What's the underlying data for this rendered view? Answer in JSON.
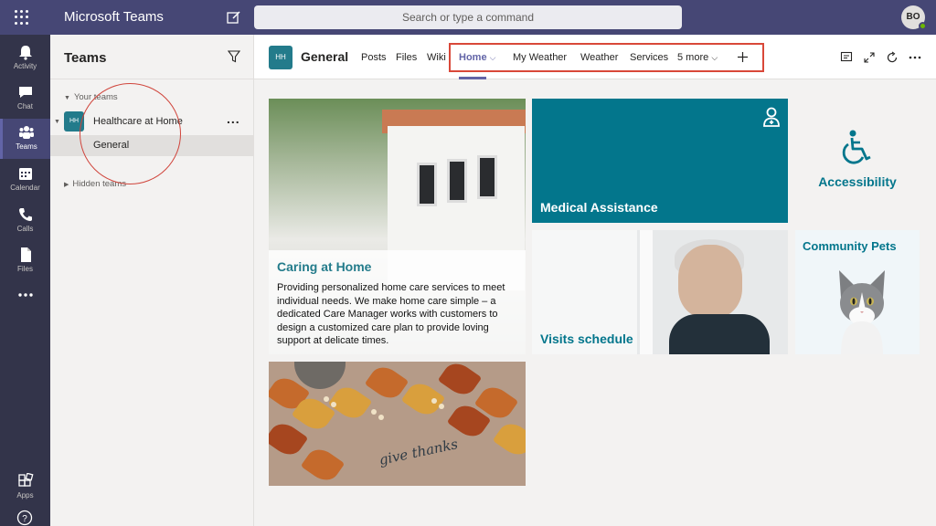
{
  "titlebar": {
    "app_title": "Microsoft Teams",
    "search_placeholder": "Search or type a command",
    "avatar_initials": "BO"
  },
  "appbar": {
    "items": [
      {
        "label": "Activity",
        "icon": "bell-icon"
      },
      {
        "label": "Chat",
        "icon": "chat-icon"
      },
      {
        "label": "Teams",
        "icon": "teams-icon"
      },
      {
        "label": "Calendar",
        "icon": "calendar-icon"
      },
      {
        "label": "Calls",
        "icon": "phone-icon"
      },
      {
        "label": "Files",
        "icon": "file-icon"
      },
      {
        "label": "",
        "icon": "more-icon"
      }
    ],
    "apps_label": "Apps"
  },
  "teams_pane": {
    "header": "Teams",
    "your_teams_label": "Your teams",
    "team": {
      "initials": "HH",
      "name": "Healthcare at Home",
      "more": "..."
    },
    "channel": "General",
    "hidden_teams_label": "Hidden teams"
  },
  "channel_header": {
    "initials": "HH",
    "title": "General",
    "tabs": [
      "Posts",
      "Files",
      "Wiki",
      "Home",
      "My Weather",
      "Weather",
      "Services",
      "5 more"
    ],
    "active_tab": "Home"
  },
  "tiles": {
    "caring": {
      "title": "Caring at Home",
      "text": "Providing personalized home care services to meet individual needs. We make home care simple – a dedicated Care Manager works with customers to design a customized care plan to provide loving support at delicate times."
    },
    "medical": {
      "title": "Medical Assistance"
    },
    "accessibility": {
      "title": "Accessibility"
    },
    "visits": {
      "title": "Visits schedule"
    },
    "pets": {
      "title": "Community Pets"
    },
    "thanks": {
      "handwriting": "give thanks"
    }
  },
  "colors": {
    "titlebar": "#464775",
    "appbar": "#33344a",
    "accent": "#6264a7",
    "teal": "#03768c",
    "annotation": "#d94839"
  }
}
